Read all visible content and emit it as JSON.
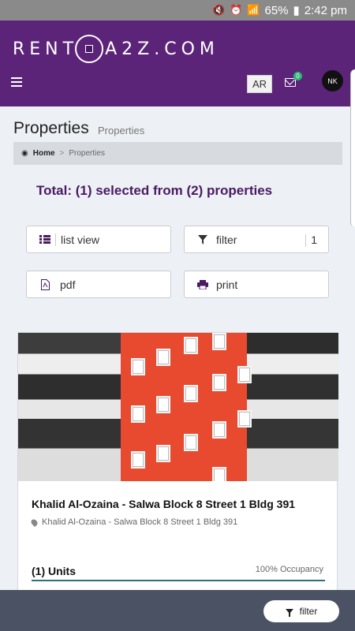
{
  "status_bar": {
    "battery": "65%",
    "time": "2:42 pm"
  },
  "header": {
    "logo_prefix": "RENT",
    "logo_suffix": "A2Z.COM",
    "language_button": "AR",
    "mail_badge": "0",
    "avatar_initials": "NK"
  },
  "page": {
    "title": "Properties",
    "subtitle": "Properties"
  },
  "breadcrumb": {
    "home": "Home",
    "separator": ">",
    "current": "Properties"
  },
  "summary": {
    "total_text": "Total:  (1) selected from (2) properties"
  },
  "toolbar": {
    "list_view": "list view",
    "filter": "filter",
    "filter_count": "1",
    "pdf": "pdf",
    "print": "print"
  },
  "property": {
    "title": "Khalid Al-Ozaina - Salwa Block 8 Street 1 Bldg 391",
    "address": "Khalid Al-Ozaina - Salwa Block 8 Street 1 Bldg 391",
    "units_label": "(1) Units",
    "occupancy": "100% Occupancy",
    "occupancy_fraction": 1.0
  },
  "bottom_bar": {
    "filter_button": "filter"
  },
  "colors": {
    "brand": "#5c2479",
    "accent_text": "#4a1a63",
    "badge": "#2bb673"
  }
}
